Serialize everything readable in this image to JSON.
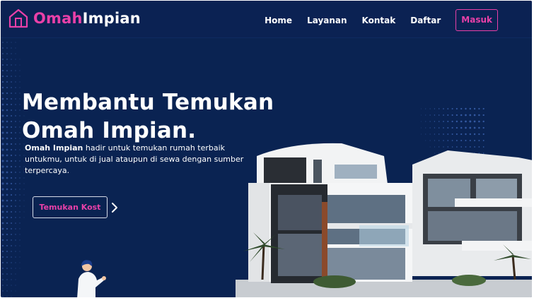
{
  "brand": {
    "part1": "Omah",
    "part2": "Impian"
  },
  "nav": {
    "items": [
      "Home",
      "Layanan",
      "Kontak",
      "Daftar"
    ],
    "login_label": "Masuk"
  },
  "hero": {
    "title_line1": "Membantu Temukan",
    "title_line2": "Omah Impian.",
    "desc_bold": "Omah Impian",
    "desc_rest": " hadir untuk temukan rumah terbaik untukmu, untuk di jual ataupun di sewa dengan sumber terpercaya.",
    "cta_label": "Temukan Kost"
  },
  "colors": {
    "background": "#0a2352",
    "accent": "#e940a8",
    "text": "#ffffff"
  },
  "icons": {
    "logo": "house-outline-icon",
    "cta_arrow": "chevron-right-icon"
  }
}
